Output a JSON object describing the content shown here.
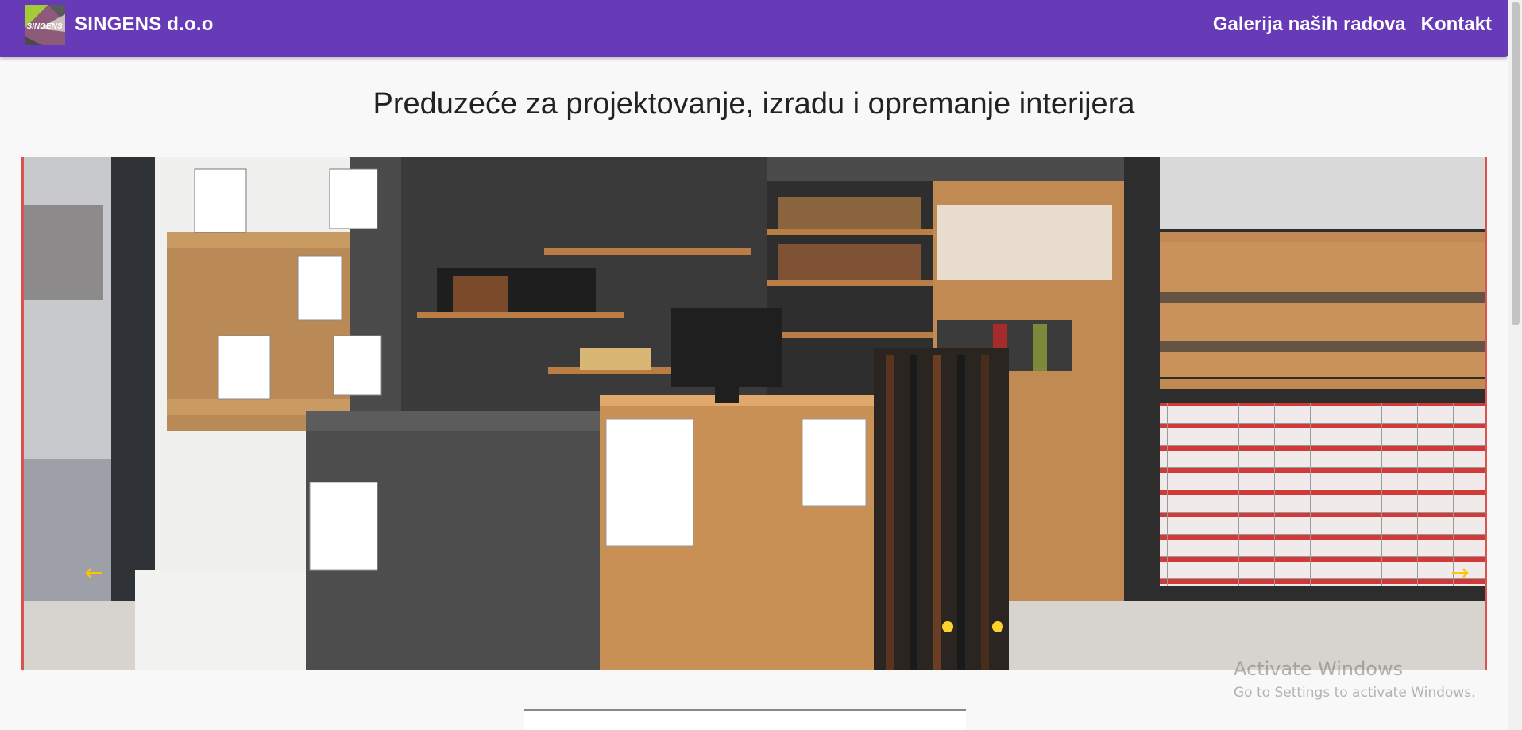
{
  "header": {
    "brand_name": "SINGENS d.o.o",
    "logo_text": "SINGENS",
    "nav": [
      {
        "label": "Galerija naših radova"
      },
      {
        "label": "Kontakt"
      }
    ],
    "color": "#673ab7"
  },
  "main": {
    "title": "Preduzeće za projektovanje, izradu i opremanje interijera"
  },
  "carousel": {
    "prev_icon": "arrow-left-icon",
    "next_icon": "arrow-right-icon",
    "slide_count": 2,
    "accent_color": "#ffc400"
  },
  "watermark": {
    "title": "Activate Windows",
    "subtitle": "Go to Settings to activate Windows."
  }
}
